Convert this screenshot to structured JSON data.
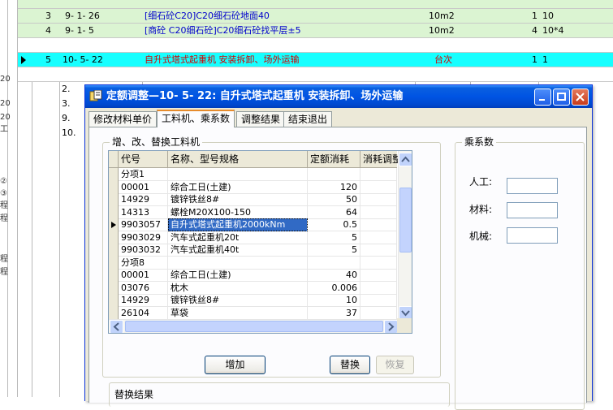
{
  "sheet": {
    "side_chars": [
      "20",
      "20",
      "20",
      "工",
      "②",
      "③",
      "程",
      "程",
      "程",
      "程"
    ],
    "rows": [
      {
        "seq": "3",
        "code": "9- 1- 26",
        "name": "[细石砼C20]C20细石砼地面40",
        "unit": "10m2",
        "qty": "1",
        "expr": "10",
        "style": "green"
      },
      {
        "seq": "4",
        "code": "9- 1- 5",
        "name": "[商砼 C20细石砼]C20细石砼找平层±5",
        "unit": "10m2",
        "qty": "4",
        "expr": "10*4",
        "style": "green"
      },
      {
        "seq": "5",
        "code": "10- 5- 22",
        "name": "自升式塔式起重机 安装拆卸、场外运输",
        "unit": "台次",
        "qty": "1",
        "expr": "1",
        "style": "cyan"
      }
    ],
    "sub_rows": [
      "2.",
      "3.",
      "9.",
      "10."
    ]
  },
  "dialog": {
    "title": "定额调整—10- 5-   22: 自升式塔式起重机 安装拆卸、场外运输",
    "tabs": [
      "修改材料单价",
      "工料机、乘系数",
      "调整结果",
      "结束退出"
    ],
    "group_replace_title": "增、改、替换工料机",
    "group_coef_title": "乘系数",
    "columns": [
      "代号",
      "名称、型号规格",
      "定额消耗",
      "消耗调整"
    ],
    "rows": [
      {
        "code": "分项1",
        "name": "",
        "qty": ""
      },
      {
        "code": "00001",
        "name": "综合工日(土建)",
        "qty": "120"
      },
      {
        "code": "14929",
        "name": "镀锌铁丝8#",
        "qty": "50"
      },
      {
        "code": "14313",
        "name": "螺栓M20X100-150",
        "qty": "64"
      },
      {
        "code": "9903057",
        "name": "自升式塔式起重机2000kNm",
        "qty": "0.5",
        "selected": true
      },
      {
        "code": "9903029",
        "name": "汽车式起重机20t",
        "qty": "5"
      },
      {
        "code": "9903032",
        "name": "汽车式起重机40t",
        "qty": "5"
      },
      {
        "code": "分项8",
        "name": "",
        "qty": ""
      },
      {
        "code": "00001",
        "name": "综合工日(土建)",
        "qty": "40"
      },
      {
        "code": "03076",
        "name": "枕木",
        "qty": "0.006"
      },
      {
        "code": "14929",
        "name": "镀锌铁丝8#",
        "qty": "10"
      },
      {
        "code": "26104",
        "name": "草袋",
        "qty": "37"
      }
    ],
    "buttons": {
      "add": "增加",
      "replace": "替换",
      "restore": "恢复"
    },
    "coef_labels": {
      "labor": "人工:",
      "material": "材料:",
      "machine": "机械:"
    },
    "result_label": "替换结果"
  },
  "colors": {
    "green_row": "#dbf4d2",
    "cyan_row": "#17ffff",
    "titlebar": "#0054e3",
    "selection": "#316ac5"
  }
}
